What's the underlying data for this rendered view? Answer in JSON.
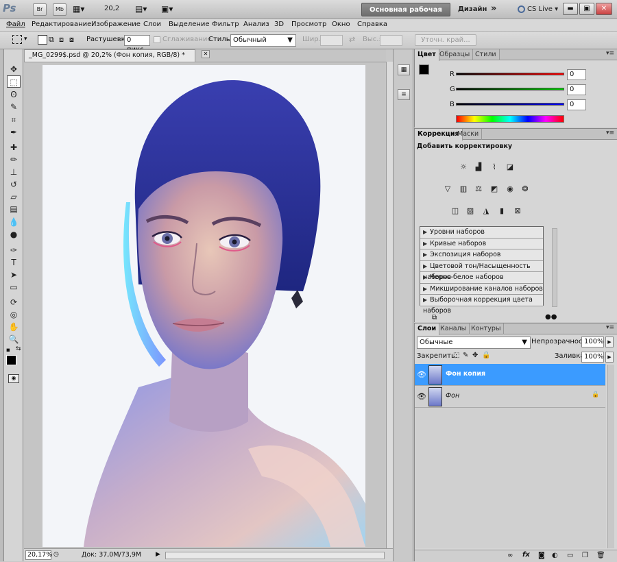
{
  "appbar": {
    "logo": "Ps",
    "br": "Br",
    "mb": "Mb",
    "zoom": "20,2",
    "workspace": "Основная рабочая среда",
    "design": "Дизайн",
    "more": "»",
    "cslive": "CS Live"
  },
  "menu": [
    "Файл",
    "Редактирование",
    "Изображение",
    "Слои",
    "Выделение",
    "Фильтр",
    "Анализ",
    "3D",
    "Просмотр",
    "Окно",
    "Справка"
  ],
  "options": {
    "feather_label": "Растушевка:",
    "feather_value": "0 пикс.",
    "antialias_label": "Сглаживание",
    "style_label": "Стиль:",
    "style_value": "Обычный",
    "width_label": "Шир.:",
    "height_label": "Выс.:",
    "refine_label": "Уточн. край..."
  },
  "document": {
    "tab_title": "_MG_0299$.psd @ 20,2% (Фон копия, RGB/8) *",
    "zoom_status": "20,17%",
    "doc_status": "Док: 37,0M/73,9M"
  },
  "color_panel": {
    "tabs": [
      "Цвет",
      "Образцы",
      "Стили"
    ],
    "channels": [
      {
        "label": "R",
        "value": "0",
        "color": "#d00000"
      },
      {
        "label": "G",
        "value": "0",
        "color": "#00a000"
      },
      {
        "label": "B",
        "value": "0",
        "color": "#0000d0"
      }
    ]
  },
  "adjust_panel": {
    "tabs": [
      "Коррекция",
      "Маски"
    ],
    "title": "Добавить корректировку",
    "presets": [
      "Уровни наборов",
      "Кривые наборов",
      "Экспозиция наборов",
      "Цветовой тон/Насыщенность наборов",
      "Черно-белое наборов",
      "Микширование каналов наборов",
      "Выборочная коррекция цвета наборов"
    ]
  },
  "layers_panel": {
    "tabs": [
      "Слои",
      "Каналы",
      "Контуры"
    ],
    "blend_mode": "Обычные",
    "opacity_label": "Непрозрачность:",
    "opacity_value": "100%",
    "lock_label": "Закрепить:",
    "fill_label": "Заливка:",
    "fill_value": "100%",
    "layers": [
      {
        "name": "Фон копия",
        "selected": true
      },
      {
        "name": "Фон",
        "selected": false
      }
    ]
  }
}
